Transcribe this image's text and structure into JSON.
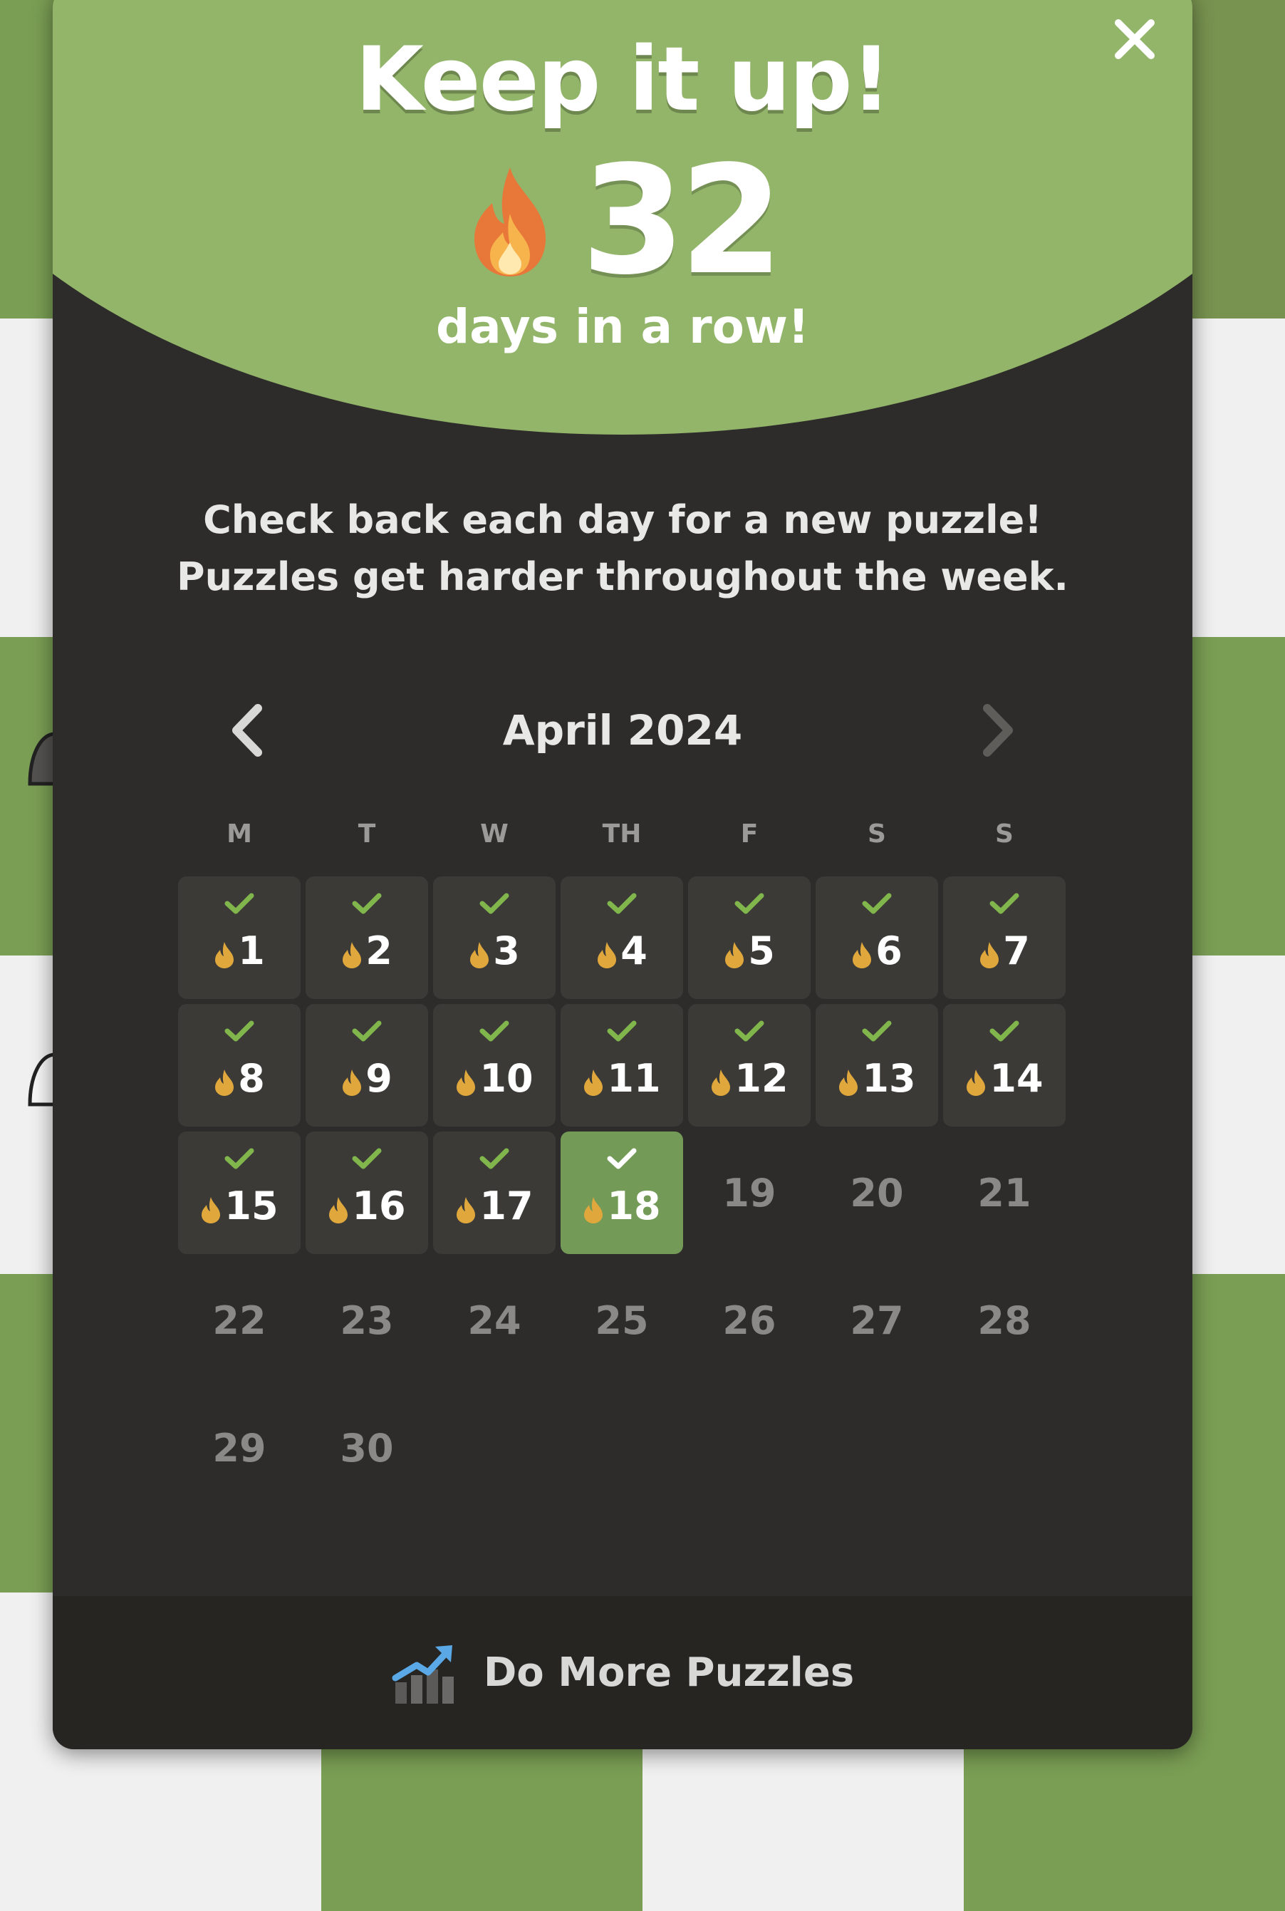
{
  "modal": {
    "title": "Keep it up!",
    "streak_count": "32",
    "streak_label": "days in a row!",
    "message_line1": "Check back each day for a new puzzle!",
    "message_line2": "Puzzles get harder throughout the week."
  },
  "calendar": {
    "month": "April 2024",
    "weekdays": [
      "M",
      "T",
      "W",
      "TH",
      "F",
      "S",
      "S"
    ],
    "days": [
      {
        "n": "1",
        "state": "done"
      },
      {
        "n": "2",
        "state": "done"
      },
      {
        "n": "3",
        "state": "done"
      },
      {
        "n": "4",
        "state": "done"
      },
      {
        "n": "5",
        "state": "done"
      },
      {
        "n": "6",
        "state": "done"
      },
      {
        "n": "7",
        "state": "done"
      },
      {
        "n": "8",
        "state": "done"
      },
      {
        "n": "9",
        "state": "done"
      },
      {
        "n": "10",
        "state": "done"
      },
      {
        "n": "11",
        "state": "done"
      },
      {
        "n": "12",
        "state": "done"
      },
      {
        "n": "13",
        "state": "done"
      },
      {
        "n": "14",
        "state": "done"
      },
      {
        "n": "15",
        "state": "done"
      },
      {
        "n": "16",
        "state": "done"
      },
      {
        "n": "17",
        "state": "done"
      },
      {
        "n": "18",
        "state": "today"
      },
      {
        "n": "19",
        "state": "future"
      },
      {
        "n": "20",
        "state": "future"
      },
      {
        "n": "21",
        "state": "future"
      },
      {
        "n": "22",
        "state": "future"
      },
      {
        "n": "23",
        "state": "future"
      },
      {
        "n": "24",
        "state": "future"
      },
      {
        "n": "25",
        "state": "future"
      },
      {
        "n": "26",
        "state": "future"
      },
      {
        "n": "27",
        "state": "future"
      },
      {
        "n": "28",
        "state": "future"
      },
      {
        "n": "29",
        "state": "future"
      },
      {
        "n": "30",
        "state": "future"
      }
    ]
  },
  "footer": {
    "label": "Do More Puzzles",
    "icon": "trending-chart-icon"
  },
  "icons": {
    "close": "close-icon",
    "prev": "chevron-left-icon",
    "next": "chevron-right-icon",
    "flame": "flame-icon",
    "check": "check-icon"
  },
  "colors": {
    "header_green": "#93b56a",
    "modal_bg": "#2d2c2a",
    "today_green": "#739a57",
    "check_green": "#81b64c",
    "flame_gold": "#e0a83c"
  }
}
